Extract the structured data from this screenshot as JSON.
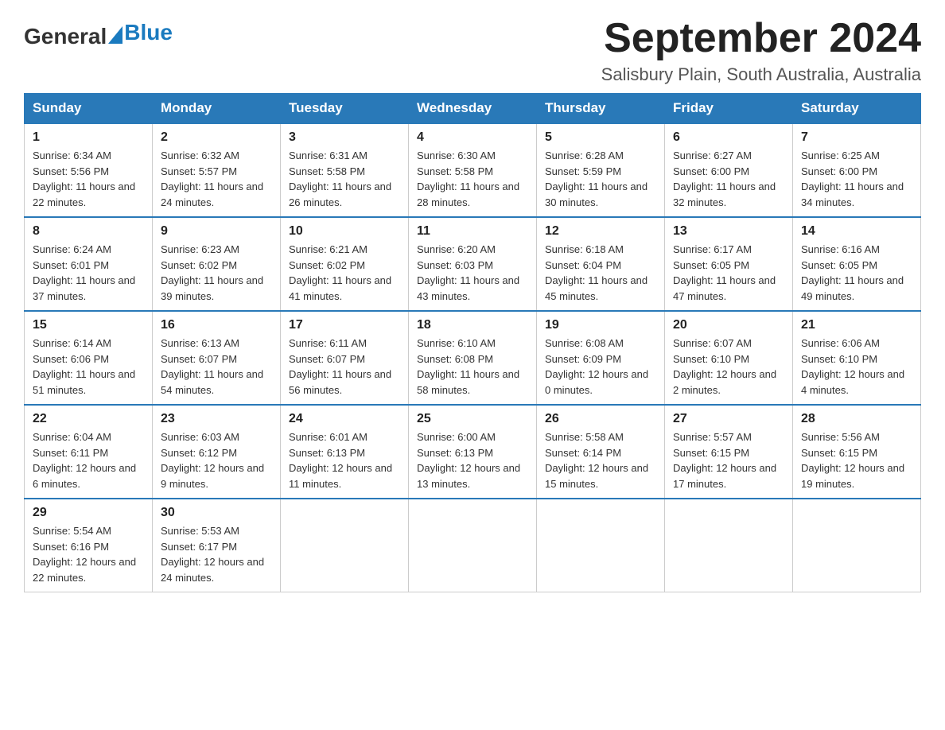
{
  "header": {
    "logo_general": "General",
    "logo_blue": "Blue",
    "title": "September 2024",
    "location": "Salisbury Plain, South Australia, Australia"
  },
  "calendar": {
    "days_of_week": [
      "Sunday",
      "Monday",
      "Tuesday",
      "Wednesday",
      "Thursday",
      "Friday",
      "Saturday"
    ],
    "weeks": [
      [
        {
          "day": "1",
          "sunrise": "6:34 AM",
          "sunset": "5:56 PM",
          "daylight": "11 hours and 22 minutes."
        },
        {
          "day": "2",
          "sunrise": "6:32 AM",
          "sunset": "5:57 PM",
          "daylight": "11 hours and 24 minutes."
        },
        {
          "day": "3",
          "sunrise": "6:31 AM",
          "sunset": "5:58 PM",
          "daylight": "11 hours and 26 minutes."
        },
        {
          "day": "4",
          "sunrise": "6:30 AM",
          "sunset": "5:58 PM",
          "daylight": "11 hours and 28 minutes."
        },
        {
          "day": "5",
          "sunrise": "6:28 AM",
          "sunset": "5:59 PM",
          "daylight": "11 hours and 30 minutes."
        },
        {
          "day": "6",
          "sunrise": "6:27 AM",
          "sunset": "6:00 PM",
          "daylight": "11 hours and 32 minutes."
        },
        {
          "day": "7",
          "sunrise": "6:25 AM",
          "sunset": "6:00 PM",
          "daylight": "11 hours and 34 minutes."
        }
      ],
      [
        {
          "day": "8",
          "sunrise": "6:24 AM",
          "sunset": "6:01 PM",
          "daylight": "11 hours and 37 minutes."
        },
        {
          "day": "9",
          "sunrise": "6:23 AM",
          "sunset": "6:02 PM",
          "daylight": "11 hours and 39 minutes."
        },
        {
          "day": "10",
          "sunrise": "6:21 AM",
          "sunset": "6:02 PM",
          "daylight": "11 hours and 41 minutes."
        },
        {
          "day": "11",
          "sunrise": "6:20 AM",
          "sunset": "6:03 PM",
          "daylight": "11 hours and 43 minutes."
        },
        {
          "day": "12",
          "sunrise": "6:18 AM",
          "sunset": "6:04 PM",
          "daylight": "11 hours and 45 minutes."
        },
        {
          "day": "13",
          "sunrise": "6:17 AM",
          "sunset": "6:05 PM",
          "daylight": "11 hours and 47 minutes."
        },
        {
          "day": "14",
          "sunrise": "6:16 AM",
          "sunset": "6:05 PM",
          "daylight": "11 hours and 49 minutes."
        }
      ],
      [
        {
          "day": "15",
          "sunrise": "6:14 AM",
          "sunset": "6:06 PM",
          "daylight": "11 hours and 51 minutes."
        },
        {
          "day": "16",
          "sunrise": "6:13 AM",
          "sunset": "6:07 PM",
          "daylight": "11 hours and 54 minutes."
        },
        {
          "day": "17",
          "sunrise": "6:11 AM",
          "sunset": "6:07 PM",
          "daylight": "11 hours and 56 minutes."
        },
        {
          "day": "18",
          "sunrise": "6:10 AM",
          "sunset": "6:08 PM",
          "daylight": "11 hours and 58 minutes."
        },
        {
          "day": "19",
          "sunrise": "6:08 AM",
          "sunset": "6:09 PM",
          "daylight": "12 hours and 0 minutes."
        },
        {
          "day": "20",
          "sunrise": "6:07 AM",
          "sunset": "6:10 PM",
          "daylight": "12 hours and 2 minutes."
        },
        {
          "day": "21",
          "sunrise": "6:06 AM",
          "sunset": "6:10 PM",
          "daylight": "12 hours and 4 minutes."
        }
      ],
      [
        {
          "day": "22",
          "sunrise": "6:04 AM",
          "sunset": "6:11 PM",
          "daylight": "12 hours and 6 minutes."
        },
        {
          "day": "23",
          "sunrise": "6:03 AM",
          "sunset": "6:12 PM",
          "daylight": "12 hours and 9 minutes."
        },
        {
          "day": "24",
          "sunrise": "6:01 AM",
          "sunset": "6:13 PM",
          "daylight": "12 hours and 11 minutes."
        },
        {
          "day": "25",
          "sunrise": "6:00 AM",
          "sunset": "6:13 PM",
          "daylight": "12 hours and 13 minutes."
        },
        {
          "day": "26",
          "sunrise": "5:58 AM",
          "sunset": "6:14 PM",
          "daylight": "12 hours and 15 minutes."
        },
        {
          "day": "27",
          "sunrise": "5:57 AM",
          "sunset": "6:15 PM",
          "daylight": "12 hours and 17 minutes."
        },
        {
          "day": "28",
          "sunrise": "5:56 AM",
          "sunset": "6:15 PM",
          "daylight": "12 hours and 19 minutes."
        }
      ],
      [
        {
          "day": "29",
          "sunrise": "5:54 AM",
          "sunset": "6:16 PM",
          "daylight": "12 hours and 22 minutes."
        },
        {
          "day": "30",
          "sunrise": "5:53 AM",
          "sunset": "6:17 PM",
          "daylight": "12 hours and 24 minutes."
        },
        null,
        null,
        null,
        null,
        null
      ]
    ]
  }
}
